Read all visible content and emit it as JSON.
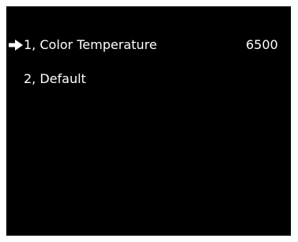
{
  "menu": {
    "items": [
      {
        "label": "1, Color Temperature",
        "value": "6500",
        "selected": true
      },
      {
        "label": "2, Default",
        "selected": false
      }
    ]
  },
  "colors": {
    "background": "#000000",
    "text": "#ffffff"
  },
  "icons": {
    "cursor": "arrow-right-icon"
  }
}
